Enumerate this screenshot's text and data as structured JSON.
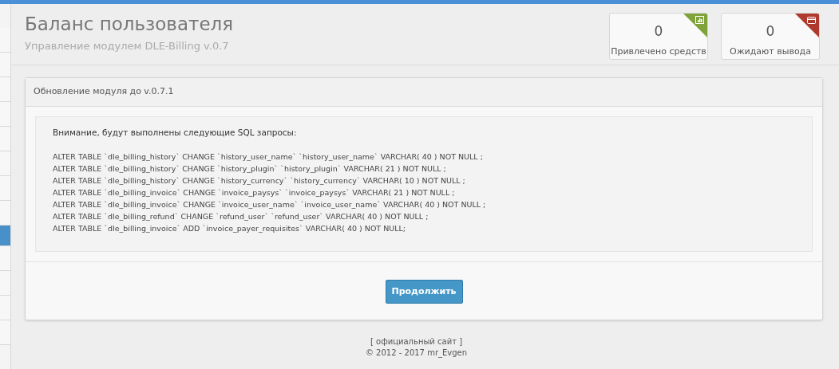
{
  "sidebar": {
    "items": [
      {
        "selected": false
      },
      {
        "selected": false
      },
      {
        "selected": false
      },
      {
        "selected": false
      },
      {
        "selected": false
      },
      {
        "selected": false
      },
      {
        "selected": false
      },
      {
        "selected": false
      },
      {
        "selected": true
      },
      {
        "selected": false
      },
      {
        "selected": false
      },
      {
        "selected": false
      },
      {
        "selected": false
      }
    ]
  },
  "header": {
    "title": "Баланс пользователя",
    "subtitle": "Управление модулем DLE-Billing v.0.7"
  },
  "stats": [
    {
      "value": "0",
      "label": "Привлечено средств",
      "color": "#7fa33a",
      "kind": "chart"
    },
    {
      "value": "0",
      "label": "Ожидают вывода",
      "color": "#b0392e",
      "kind": "card"
    }
  ],
  "panel": {
    "title": "Обновление модуля до v.0.7.1",
    "notice": "Внимание, будут выполнены следующие SQL запросы:",
    "queries": [
      "ALTER TABLE `dle_billing_history` CHANGE `history_user_name` `history_user_name` VARCHAR( 40 ) NOT NULL ;",
      "ALTER TABLE `dle_billing_history` CHANGE `history_plugin` `history_plugin` VARCHAR( 21 ) NOT NULL ;",
      "ALTER TABLE `dle_billing_history` CHANGE `history_currency` `history_currency` VARCHAR( 10 ) NOT NULL ;",
      "ALTER TABLE `dle_billing_invoice` CHANGE `invoice_paysys` `invoice_paysys` VARCHAR( 21 ) NOT NULL ;",
      "ALTER TABLE `dle_billing_invoice` CHANGE `invoice_user_name` `invoice_user_name` VARCHAR( 40 ) NOT NULL ;",
      "ALTER TABLE `dle_billing_refund` CHANGE `refund_user` `refund_user` VARCHAR( 40 ) NOT NULL ;",
      "ALTER TABLE `dle_billing_invoice` ADD `invoice_payer_requisites` VARCHAR( 40 ) NOT NULL;"
    ],
    "button": "Продолжить"
  },
  "footer": {
    "link": "[ официальный сайт ]",
    "copyright": "© 2012 - 2017 mr_Evgen"
  }
}
